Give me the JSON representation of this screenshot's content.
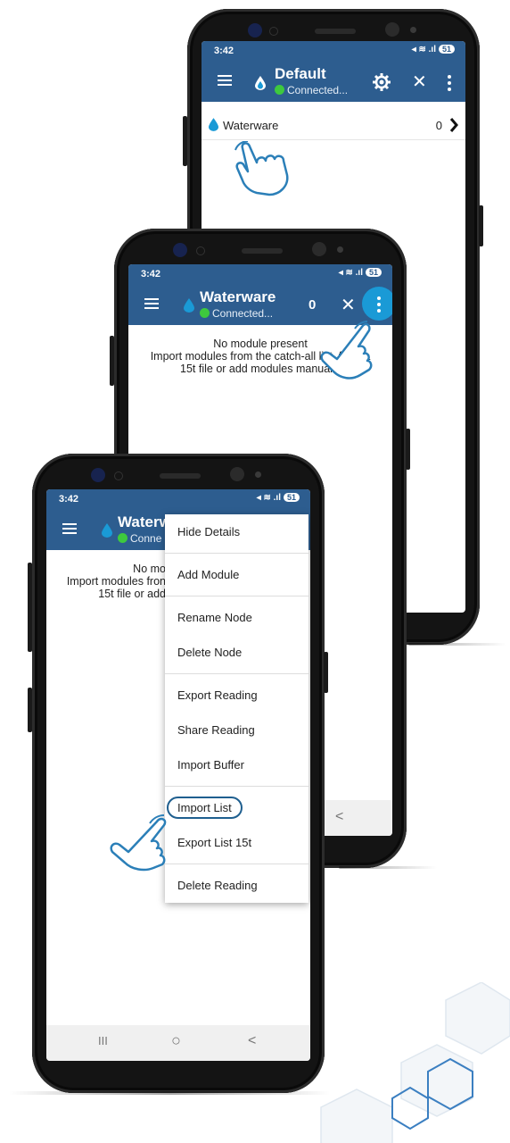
{
  "colors": {
    "appbar": "#2d5d8f",
    "accent": "#1a9ad6",
    "connected": "#3ec93e",
    "hand_outline": "#2b7fb8"
  },
  "status_bar": {
    "time": "3:42",
    "battery": "51"
  },
  "phone1": {
    "title": "Default",
    "subtitle": "Connected...",
    "list_item_label": "Waterware",
    "list_item_count": "0"
  },
  "phone2": {
    "title": "Waterware",
    "subtitle": "Connected...",
    "count": "0",
    "empty_line1": "No module present",
    "empty_line2": "Import modules from the catch-all list, from a",
    "empty_line3": "15t file or add modules manually"
  },
  "phone3": {
    "title": "Waterw",
    "subtitle": "Conne",
    "empty_line1": "No mo",
    "empty_line2": "Import modules fron",
    "empty_line3": "15t file or add",
    "menu": {
      "items": [
        "Hide Details",
        "Add Module",
        "Rename Node",
        "Delete Node",
        "Export Reading",
        "Share Reading",
        "Import Buffer",
        "Import List",
        "Export List 15t",
        "Delete Reading"
      ]
    },
    "nav": {
      "recent": "III",
      "home": "○",
      "back": "<"
    }
  },
  "icons": [
    "menu-icon",
    "water-drop-icon",
    "settings-gear-icon",
    "close-icon",
    "more-vert-icon",
    "chevron-right-icon",
    "tap-hand-icon"
  ]
}
